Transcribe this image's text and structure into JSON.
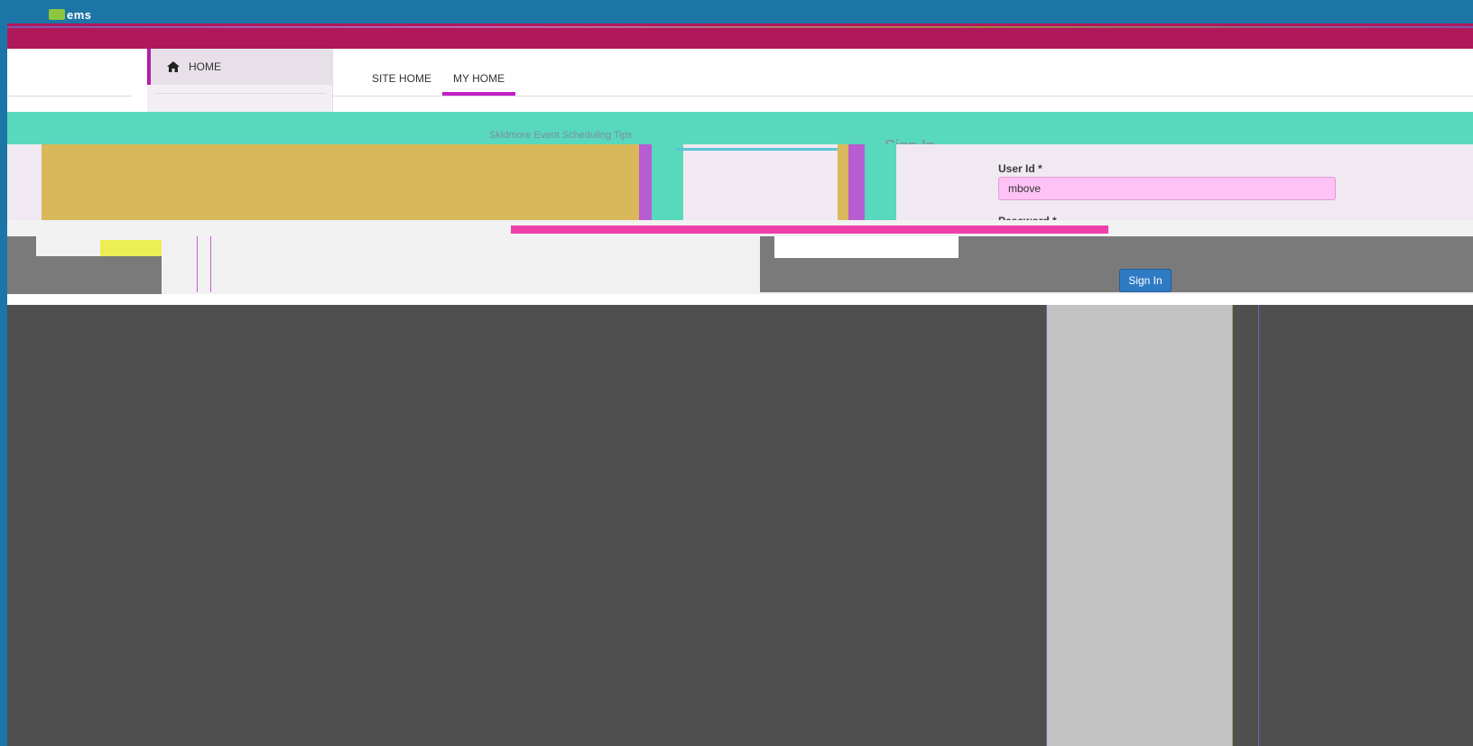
{
  "header": {
    "logo_text": "ems"
  },
  "nav": {
    "side_home_label": "HOME",
    "tabs": [
      {
        "label": "SITE HOME",
        "active": false
      },
      {
        "label": "MY HOME",
        "active": true
      }
    ]
  },
  "page": {
    "site_name": "Skidmore Event Scheduling Tips",
    "signin_title": "Sign In"
  },
  "signin": {
    "userid_label": "User Id *",
    "userid_value": "mbove",
    "password_label": "Password *",
    "button_label": "Sign In"
  },
  "colors": {
    "accent": "#c21fc8",
    "brand_bar": "#b0185a",
    "topbar": "#1b75a6",
    "button": "#2e7bc4",
    "input_bg": "#ffc2f5"
  },
  "icons": {
    "home": "home-icon"
  }
}
